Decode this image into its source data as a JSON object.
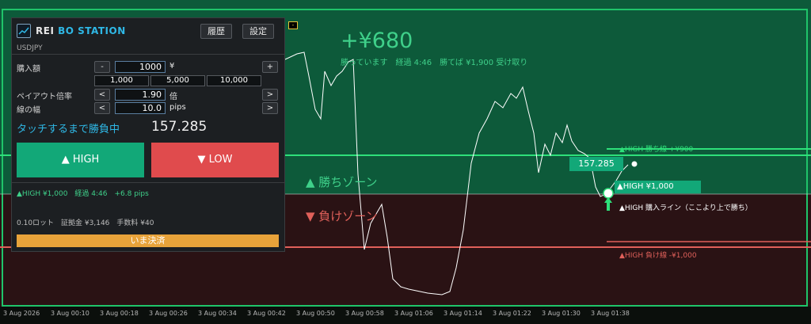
{
  "panel": {
    "logo_text_main": "REI",
    "logo_text_accent": "BO STATION",
    "history_label": "履歴",
    "settings_label": "設定",
    "symbol": "USDJPY",
    "amount_label": "購入額",
    "amount_minus": "-",
    "amount_value": "1000",
    "amount_unit": "¥",
    "amount_plus": "+",
    "presets": [
      "1,000",
      "5,000",
      "10,000"
    ],
    "payout_label": "ペイアウト倍率",
    "payout_dec": "<",
    "payout_value": "1.90",
    "payout_unit": "倍",
    "payout_inc": ">",
    "width_label": "線の幅",
    "width_dec": "<",
    "width_value": "10.0",
    "width_unit": "pips",
    "width_inc": ">",
    "touch_label": "タッチするまで勝負中",
    "current_price": "157.285",
    "high_button": "▲ HIGH",
    "low_button": "▼ LOW",
    "position_summary": "▲HIGH ¥1,000　経過 4:46　+6.8 pips",
    "lot_summary": "0.10ロット　証拠金 ¥3,146　手数料 ¥40",
    "settle_label": "いま決済"
  },
  "chart": {
    "pnl": "+¥680",
    "status": "勝っています　経過 4:46　勝てば ¥1,900 受け取り",
    "win_zone_label": "▲ 勝ちゾーン",
    "lose_zone_label": "▼ 負けゾーン",
    "win_line_label": "▲HIGH 勝ち線 +¥900",
    "lose_line_label": "▲HIGH 負け線 -¥1,000",
    "price_tag": "157.285",
    "high_tag": "▲HIGH ¥1,000",
    "buy_line_label": "▲HIGH 購入ライン（ここより上で勝ち）",
    "collapse_label": "-",
    "time_ticks": [
      "3 Aug 2026",
      "3 Aug 00:10",
      "3 Aug 00:18",
      "3 Aug 00:26",
      "3 Aug 00:34",
      "3 Aug 00:42",
      "3 Aug 00:50",
      "3 Aug 00:58",
      "3 Aug 01:06",
      "3 Aug 01:14",
      "3 Aug 01:22",
      "3 Aug 01:30",
      "3 Aug 01:38"
    ]
  },
  "colors": {
    "win_zone": "#0d5a3a",
    "lose_zone": "#2a1214",
    "win_line": "#2ee07a",
    "lose_line": "#e0605a",
    "accent_green": "#12a878",
    "accent_red": "#e04b4d",
    "settle": "#e8a33a"
  }
}
